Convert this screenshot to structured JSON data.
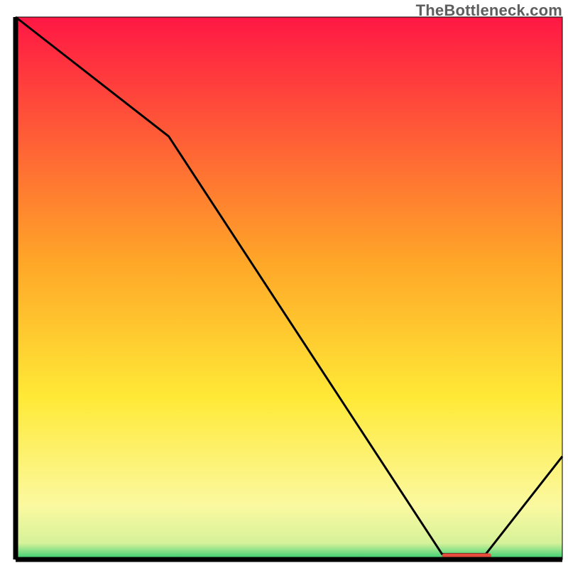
{
  "watermark": "TheBottleneck.com",
  "chart_data": {
    "type": "line",
    "title": "",
    "xlabel": "",
    "ylabel": "",
    "xlim": [
      0,
      100
    ],
    "ylim": [
      0,
      100
    ],
    "x": [
      0,
      28,
      78,
      86,
      100
    ],
    "values": [
      100,
      78,
      1,
      1,
      19
    ],
    "highlight_region": {
      "x_start": 78,
      "x_end": 87,
      "y": 0.6
    },
    "background_gradient": {
      "stops": [
        {
          "pos": 0.0,
          "color": "#ff1744"
        },
        {
          "pos": 0.45,
          "color": "#ffa628"
        },
        {
          "pos": 0.7,
          "color": "#ffe936"
        },
        {
          "pos": 0.9,
          "color": "#fbf9a0"
        },
        {
          "pos": 0.97,
          "color": "#d6f29a"
        },
        {
          "pos": 1.0,
          "color": "#2ecc71"
        }
      ]
    }
  }
}
